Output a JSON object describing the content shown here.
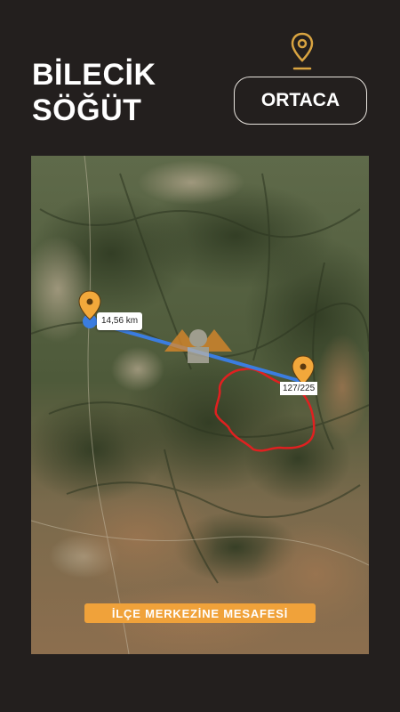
{
  "header": {
    "province": "BİLECİK",
    "district": "SÖĞÜT",
    "location_button": "ORTACA",
    "pin_icon": "map-pin-icon"
  },
  "map": {
    "distance_label": "14,56 km",
    "parcel_label": "127/225",
    "caption": "İLÇE MERKEZİNE MESAFESİ",
    "colors": {
      "pin": "#f2a83b",
      "route": "#3b7de0",
      "parcel_outline": "#e02020",
      "caption_bg": "#f0a23a"
    }
  }
}
